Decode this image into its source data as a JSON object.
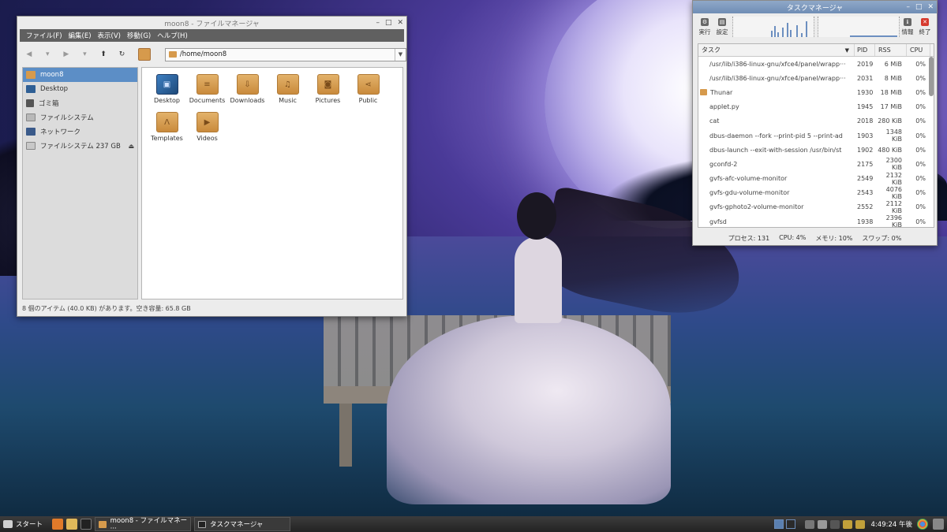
{
  "colors": {
    "selection": "#5c8ec6",
    "folder": "#d69a4c",
    "menubar": "#606060",
    "taskbar": "#2a2a2a",
    "close_red": "#d63a2e"
  },
  "file_manager": {
    "title": "moon8 - ファイルマネージャ",
    "menu": [
      "ファイル(F)",
      "編集(E)",
      "表示(V)",
      "移動(G)",
      "ヘルプ(H)"
    ],
    "address": "/home/moon8",
    "sidebar": [
      {
        "label": "moon8",
        "icon": "home-folder-icon"
      },
      {
        "label": "Desktop",
        "icon": "desktop-icon"
      },
      {
        "label": "ゴミ箱",
        "icon": "trash-icon"
      },
      {
        "label": "ファイルシステム",
        "icon": "filesystem-icon"
      },
      {
        "label": "ネットワーク",
        "icon": "network-icon"
      },
      {
        "label": "ファイルシステム 237 GB",
        "icon": "drive-icon"
      }
    ],
    "files": [
      {
        "label": "Desktop",
        "glyph": "▣"
      },
      {
        "label": "Documents",
        "glyph": "≡"
      },
      {
        "label": "Downloads",
        "glyph": "⇩"
      },
      {
        "label": "Music",
        "glyph": "♫"
      },
      {
        "label": "Pictures",
        "glyph": "◙"
      },
      {
        "label": "Public",
        "glyph": "⋖"
      },
      {
        "label": "Templates",
        "glyph": "Λ"
      },
      {
        "label": "Videos",
        "glyph": "▶"
      }
    ],
    "status": "8 個のアイテム (40.0 KB) があります。空き容量: 65.8 GB"
  },
  "task_manager": {
    "title": "タスクマネージャ",
    "buttons": {
      "run": "実行",
      "settings": "設定",
      "info": "情報",
      "quit": "終了"
    },
    "headers": {
      "task": "タスク",
      "pid": "PID",
      "rss": "RSS",
      "cpu": "CPU"
    },
    "rows": [
      {
        "task": "/usr/lib/i386-linux-gnu/xfce4/panel/wrapp···",
        "pid": "2019",
        "rss": "6 MiB",
        "cpu": "0%"
      },
      {
        "task": "/usr/lib/i386-linux-gnu/xfce4/panel/wrapp···",
        "pid": "2031",
        "rss": "8 MiB",
        "cpu": "0%"
      },
      {
        "task": "Thunar",
        "pid": "1930",
        "rss": "18 MiB",
        "cpu": "0%"
      },
      {
        "task": "applet.py",
        "pid": "1945",
        "rss": "17 MiB",
        "cpu": "0%"
      },
      {
        "task": "cat",
        "pid": "2018",
        "rss": "280 KiB",
        "cpu": "0%"
      },
      {
        "task": "dbus-daemon --fork --print-pid 5 --print-ad",
        "pid": "1903",
        "rss": "1348 KiB",
        "cpu": "0%"
      },
      {
        "task": "dbus-launch --exit-with-session /usr/bin/st",
        "pid": "1902",
        "rss": "480 KiB",
        "cpu": "0%"
      },
      {
        "task": "gconfd-2",
        "pid": "2175",
        "rss": "2300 KiB",
        "cpu": "0%"
      },
      {
        "task": "gvfs-afc-volume-monitor",
        "pid": "2549",
        "rss": "2132 KiB",
        "cpu": "0%"
      },
      {
        "task": "gvfs-gdu-volume-monitor",
        "pid": "2543",
        "rss": "4076 KiB",
        "cpu": "0%"
      },
      {
        "task": "gvfs-gphoto2-volume-monitor",
        "pid": "2552",
        "rss": "2112 KiB",
        "cpu": "0%"
      },
      {
        "task": "gvfsd",
        "pid": "1938",
        "rss": "2396 KiB",
        "cpu": "0%"
      }
    ],
    "status": {
      "processes": "プロセス: 131",
      "cpu": "CPU: 4%",
      "memory": "メモリ: 10%",
      "swap": "スワップ: 0%"
    }
  },
  "taskbar": {
    "start": "スタート",
    "tasks": [
      "moon8 - ファイルマネー···",
      "タスクマネージャ"
    ],
    "clock": "4:49:24 午後"
  }
}
